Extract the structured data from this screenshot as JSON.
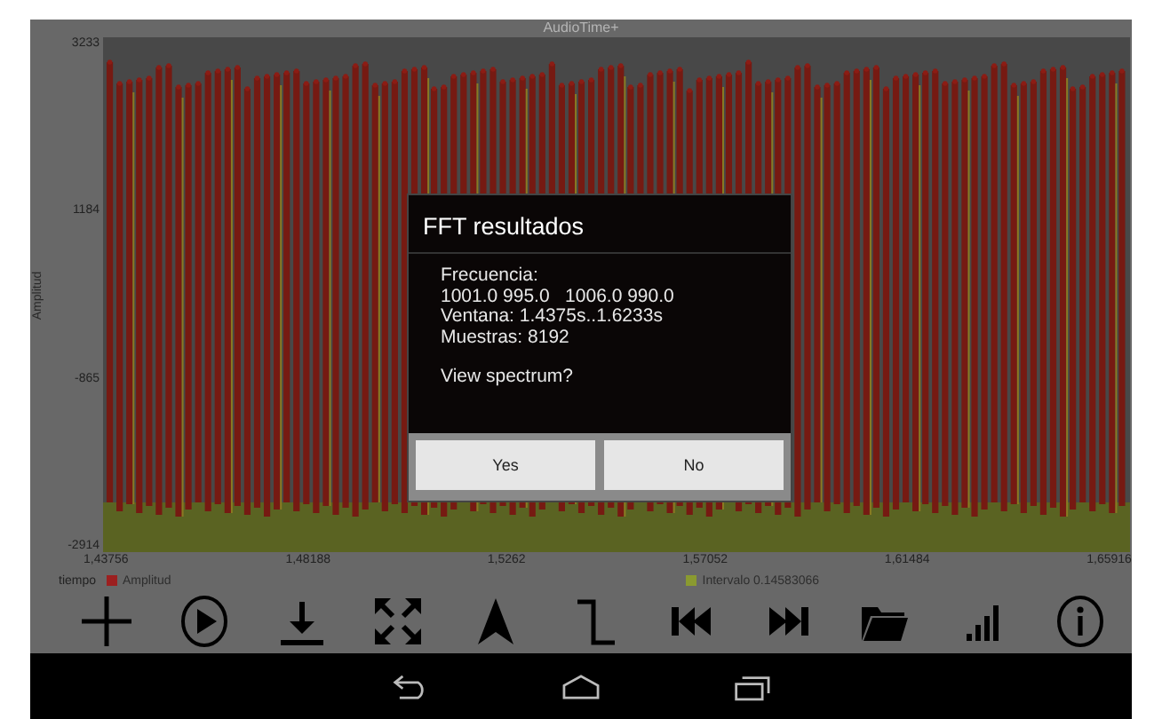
{
  "app_title": "AudioTime+",
  "chart": {
    "y_axis_title": "Amplitud",
    "y_ticks": [
      "3233",
      "1184",
      "-865",
      "-2914"
    ],
    "x_ticks": [
      "1,43756",
      "1,48188",
      "1,5262",
      "1,57052",
      "1,61484",
      "1,65916"
    ],
    "x_axis_title": "tiempo",
    "legend": [
      {
        "label": "Amplitud",
        "color": "#9c2020"
      },
      {
        "label": "Intervalo 0.14583066",
        "color": "#8a9a30"
      }
    ]
  },
  "toolbar": [
    {
      "kind": "plus"
    },
    {
      "kind": "play"
    },
    {
      "kind": "download"
    },
    {
      "kind": "expand"
    },
    {
      "kind": "arrow"
    },
    {
      "kind": "step"
    },
    {
      "kind": "previous"
    },
    {
      "kind": "next"
    },
    {
      "kind": "folder"
    },
    {
      "kind": "signal"
    },
    {
      "kind": "info"
    }
  ],
  "dialog": {
    "title": "FFT resultados",
    "lines": [
      "Frecuencia:",
      "1001.0 995.0   1006.0 990.0",
      "Ventana: 1.4375s..1.6233s",
      "Muestras: 8192"
    ],
    "question": "View spectrum?",
    "buttons": [
      "Yes",
      "No"
    ]
  },
  "nav_bar": [
    {
      "kind": "back"
    },
    {
      "kind": "home"
    },
    {
      "kind": "recents"
    }
  ]
}
